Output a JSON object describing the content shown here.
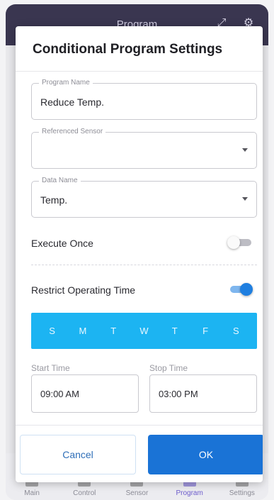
{
  "app": {
    "title": "Program",
    "nav": [
      {
        "label": "Main"
      },
      {
        "label": "Control"
      },
      {
        "label": "Sensor"
      },
      {
        "label": "Program"
      },
      {
        "label": "Settings"
      }
    ]
  },
  "dialog": {
    "title": "Conditional Program Settings",
    "program_name": {
      "label": "Program Name",
      "value": "Reduce Temp."
    },
    "referenced_sensor": {
      "label": "Referenced Sensor",
      "value": ""
    },
    "data_name": {
      "label": "Data Name",
      "value": "Temp."
    },
    "execute_once": {
      "label": "Execute Once",
      "enabled": false
    },
    "restrict_time": {
      "label": "Restrict Operating Time",
      "enabled": true
    },
    "days": [
      "S",
      "M",
      "T",
      "W",
      "T",
      "F",
      "S"
    ],
    "start_time": {
      "label": "Start Time",
      "value": "09:00 AM"
    },
    "stop_time": {
      "label": "Stop Time",
      "value": "03:00 PM"
    },
    "cancel_label": "Cancel",
    "ok_label": "OK"
  },
  "colors": {
    "accent": "#1a73d6",
    "days_bar": "#1cb4f2",
    "app_bar": "#3a3650"
  }
}
